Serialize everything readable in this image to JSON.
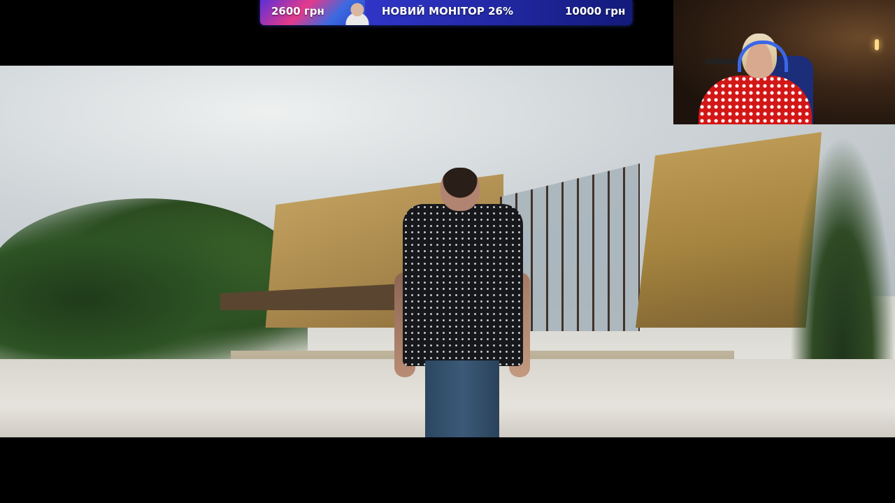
{
  "goal_bar": {
    "current": "2600 грн",
    "title": "НОВИЙ МОНІТОР 26%",
    "target": "10000 грн",
    "progress_percent": 26
  },
  "colors": {
    "goal_bar_bg": "#2a2fb8",
    "goal_fill": "#e43a8a",
    "letterbox": "#000000"
  }
}
